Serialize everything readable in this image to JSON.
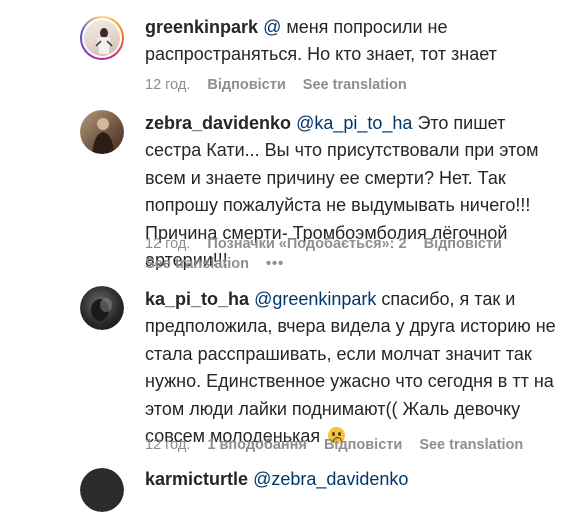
{
  "comments": [
    {
      "username": "greenkinpark",
      "mention": "@",
      "text": " меня попросили не распространяться. Но кто знает, тот знает",
      "time": "12 год.",
      "reply": "Відповісти",
      "translate": "See translation"
    },
    {
      "username": "zebra_davidenko",
      "mention": "@ka_pi_to_ha",
      "text": " Это пишет сестра Кати... Вы что присутствовали при этом всем и знаете причину ее смерти? Нет. Так попрошу пожалуйста не выдумывать ничего!!! Причина смерти- Тромбоэмболия лёгочной артерии!!!",
      "time": "12 год.",
      "likes": "Позначки «Подобається»: 2",
      "reply": "Відповісти",
      "translate": "See translation",
      "more": "•••"
    },
    {
      "username": "ka_pi_to_ha",
      "mention": "@greenkinpark",
      "text": " спасибо, я так и предположила, вчера видела у друга историю не стала расспрашивать, если молчат значит так нужно. Единственное ужасно что сегодня в тт на этом люди лайки поднимают(( Жаль девочку совсем молоденькая",
      "emoji": "sad-face-emoji",
      "time": "12 год.",
      "likes": "1 вподобання",
      "reply": "Відповісти",
      "translate": "See translation"
    },
    {
      "username": "karmicturtle",
      "mention": "@zebra_davidenko"
    }
  ],
  "colors": {
    "text": "#262626",
    "meta": "#8e8e8e",
    "mention": "#00376b"
  }
}
